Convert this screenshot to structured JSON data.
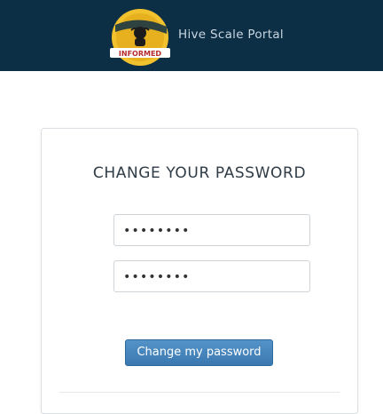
{
  "header": {
    "title": "Hive Scale Portal",
    "logo_text": "INFORMED",
    "background": "#0d2f45"
  },
  "form": {
    "heading": "CHANGE YOUR PASSWORD",
    "password_value": "••••••••",
    "confirm_value": "••••••••",
    "submit_label": "Change my password",
    "accent": "#3f7fb8"
  }
}
